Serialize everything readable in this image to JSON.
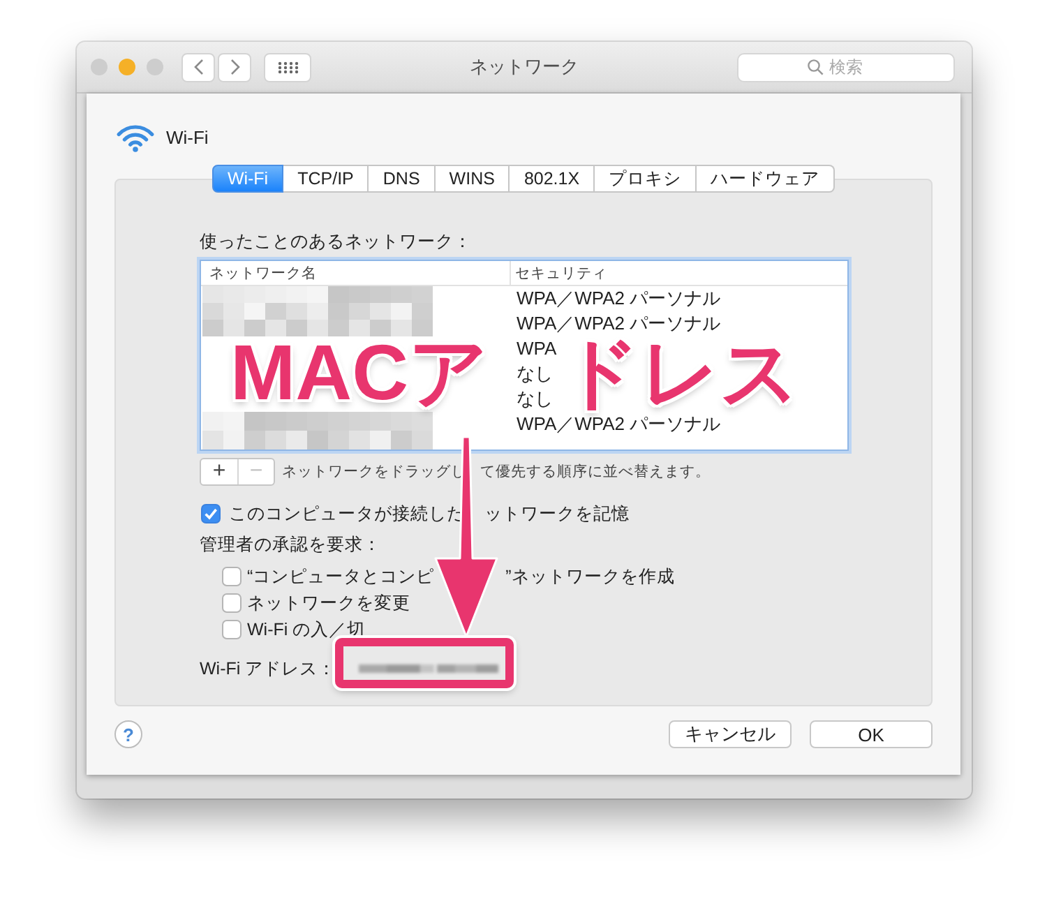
{
  "window": {
    "title": "ネットワーク",
    "traffic_lights": [
      {
        "color": "#cdcdcd"
      },
      {
        "color": "#f5b027"
      },
      {
        "color": "#cdcdcd"
      }
    ],
    "search": {
      "placeholder": "検索"
    }
  },
  "service": {
    "name": "Wi-Fi"
  },
  "tabs": [
    {
      "label": "Wi-Fi",
      "selected": true
    },
    {
      "label": "TCP/IP",
      "selected": false
    },
    {
      "label": "DNS",
      "selected": false
    },
    {
      "label": "WINS",
      "selected": false
    },
    {
      "label": "802.1X",
      "selected": false
    },
    {
      "label": "プロキシ",
      "selected": false
    },
    {
      "label": "ハードウェア",
      "selected": false
    }
  ],
  "networks": {
    "label": "使ったことのあるネットワーク：",
    "columns": [
      "ネットワーク名",
      "セキュリティ"
    ],
    "rows": [
      {
        "security": "WPA／WPA2 パーソナル"
      },
      {
        "security": "WPA／WPA2 パーソナル"
      },
      {
        "security": "WPA"
      },
      {
        "security": "なし"
      },
      {
        "security": "なし"
      },
      {
        "security": "WPA／WPA2 パーソナル"
      }
    ],
    "buttons": [
      {
        "label": "+",
        "disabled": false
      },
      {
        "label": "−",
        "disabled": true
      }
    ],
    "hint_parts": [
      "ネットワークをドラッグし",
      "て優先する順序に並べ替えます。"
    ]
  },
  "remember": {
    "label_parts": [
      "このコンピュータが接続した",
      "ットワークを記憶"
    ],
    "checked": true
  },
  "admin": {
    "label": "管理者の承認を要求：",
    "options": [
      {
        "label_parts": [
          "“コンピュータとコンピ",
          "”ネットワークを作成"
        ],
        "checked": false
      },
      {
        "label_parts": [
          "ネットワークを変更"
        ],
        "checked": false
      },
      {
        "label_parts": [
          "Wi-Fi の入／切"
        ],
        "checked": false
      }
    ]
  },
  "address": {
    "label": "Wi-Fi アドレス："
  },
  "footer": {
    "help": "?",
    "buttons": [
      "キャンセル",
      "OK"
    ]
  },
  "annotation": {
    "parts": [
      "MACア",
      "ドレス"
    ]
  }
}
